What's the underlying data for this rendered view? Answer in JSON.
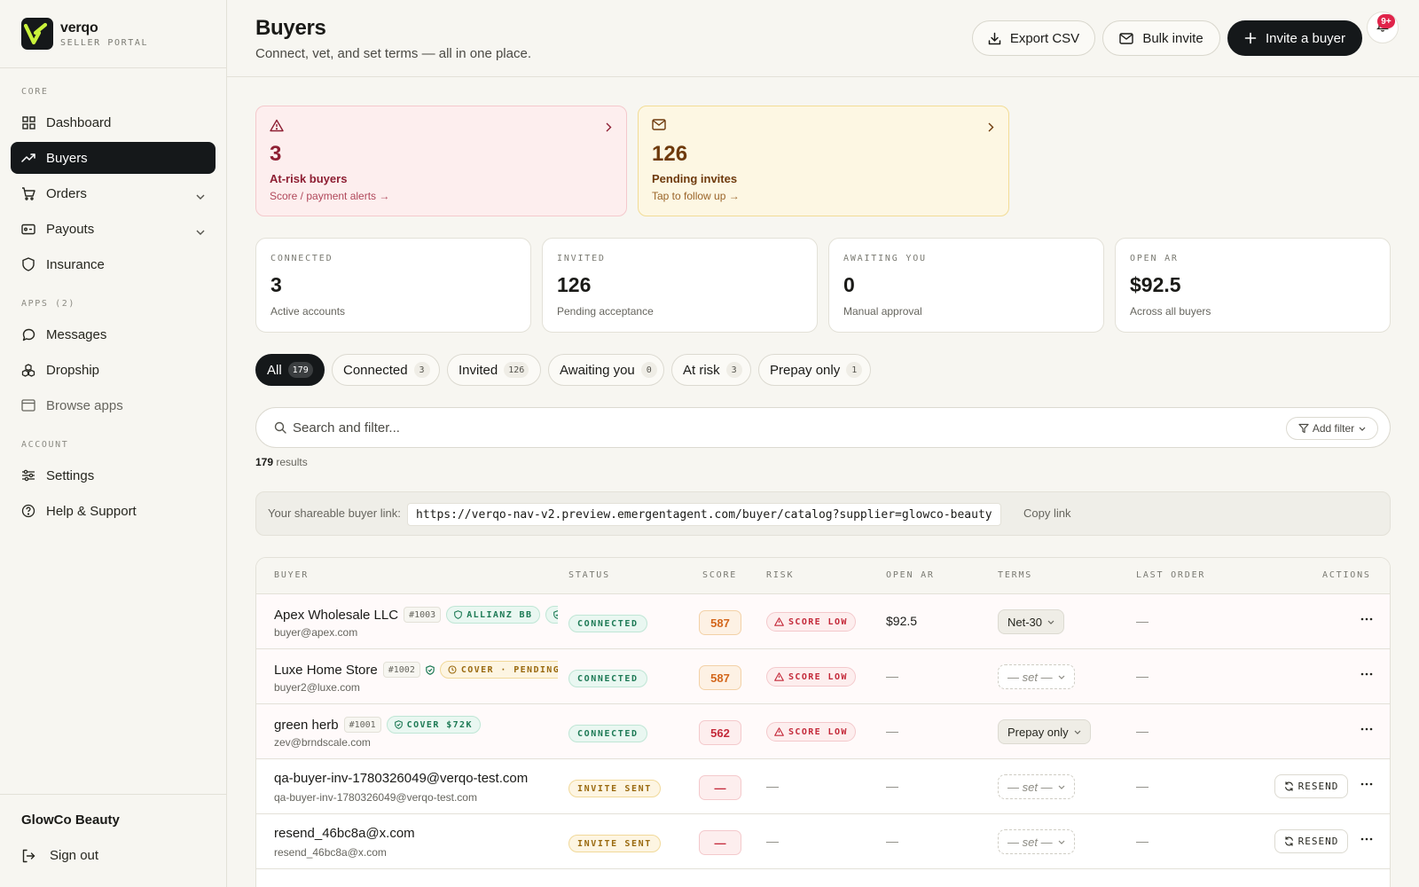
{
  "brand": {
    "name": "verqo",
    "sub": "SELLER PORTAL"
  },
  "sidebar": {
    "sections": {
      "core": "CORE",
      "apps": "APPS (2)",
      "account": "ACCOUNT"
    },
    "items": {
      "dashboard": "Dashboard",
      "buyers": "Buyers",
      "orders": "Orders",
      "payouts": "Payouts",
      "insurance": "Insurance",
      "messages": "Messages",
      "dropship": "Dropship",
      "browse": "Browse apps",
      "settings": "Settings",
      "help": "Help & Support"
    },
    "org": "GlowCo Beauty",
    "signout": "Sign out"
  },
  "header": {
    "title": "Buyers",
    "subtitle": "Connect, vet, and set terms — all in one place.",
    "export": "Export CSV",
    "bulk": "Bulk invite",
    "invite": "Invite a buyer",
    "notif_badge": "9+"
  },
  "alerts": {
    "risk": {
      "value": "3",
      "label": "At-risk buyers",
      "link": "Score / payment alerts →"
    },
    "pending": {
      "value": "126",
      "label": "Pending invites",
      "link": "Tap to follow up →"
    }
  },
  "stats": [
    {
      "label": "CONNECTED",
      "value": "3",
      "sub": "Active accounts"
    },
    {
      "label": "INVITED",
      "value": "126",
      "sub": "Pending acceptance"
    },
    {
      "label": "AWAITING YOU",
      "value": "0",
      "sub": "Manual approval"
    },
    {
      "label": "OPEN AR",
      "value": "$92.5",
      "sub": "Across all buyers"
    }
  ],
  "tabs": [
    {
      "label": "All",
      "count": "179"
    },
    {
      "label": "Connected",
      "count": "3"
    },
    {
      "label": "Invited",
      "count": "126"
    },
    {
      "label": "Awaiting you",
      "count": "0"
    },
    {
      "label": "At risk",
      "count": "3"
    },
    {
      "label": "Prepay only",
      "count": "1"
    }
  ],
  "search": {
    "placeholder": "Search and filter...",
    "add_filter": "Add filter"
  },
  "results": {
    "count": "179",
    "label": "results"
  },
  "share": {
    "label": "Your shareable buyer link:",
    "url": "https://verqo-nav-v2.preview.emergentagent.com/buyer/catalog?supplier=glowco-beauty",
    "copy": "Copy link"
  },
  "table": {
    "headers": [
      "BUYER",
      "STATUS",
      "SCORE",
      "RISK",
      "OPEN AR",
      "TERMS",
      "LAST ORDER",
      "ACTIONS"
    ],
    "dash": "—",
    "rows": [
      {
        "name": "Apex Wholesale LLC",
        "id": "#1003",
        "badge": "ALLIANZ BB",
        "badge2": "C",
        "email": "buyer@apex.com",
        "status": "CONNECTED",
        "score": "587",
        "risk": "SCORE LOW",
        "open_ar": "$92.5",
        "terms": "Net-30"
      },
      {
        "name": "Luxe Home Store",
        "id": "#1002",
        "badge": "COVER · PENDING",
        "email": "buyer2@luxe.com",
        "status": "CONNECTED",
        "score": "587",
        "risk": "SCORE LOW",
        "terms": "— set —"
      },
      {
        "name": "green herb",
        "id": "#1001",
        "badge": "COVER $72K",
        "email": "zev@brndscale.com",
        "status": "CONNECTED",
        "score": "562",
        "risk": "SCORE LOW",
        "terms": "Prepay only"
      },
      {
        "name": "qa-buyer-inv-1780326049@verqo-test.com",
        "email": "qa-buyer-inv-1780326049@verqo-test.com",
        "status": "INVITE SENT",
        "score": "—",
        "terms": "— set —",
        "action": "RESEND"
      },
      {
        "name": "resend_46bc8a@x.com",
        "email": "resend_46bc8a@x.com",
        "status": "INVITE SENT",
        "score": "—",
        "terms": "— set —",
        "action": "RESEND"
      }
    ]
  }
}
